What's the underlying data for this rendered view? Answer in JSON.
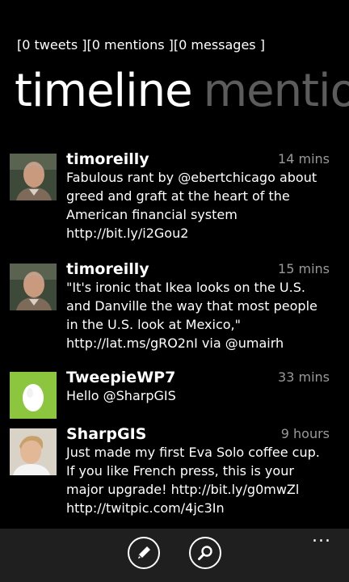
{
  "counters": "[0 tweets ][0 mentions ][0 messages ]",
  "pivot": {
    "active": "timeline",
    "next": "mentions"
  },
  "tweets": [
    {
      "user": "timoreilly",
      "time": "14 mins",
      "text": "Fabulous rant by @ebertchicago about greed and graft at the heart of the American financial system http://bit.ly/i2Gou2"
    },
    {
      "user": "timoreilly",
      "time": "15 mins",
      "text": "\"It's ironic that Ikea looks on the U.S. and Danville the way that most people in the U.S. look at Mexico,\" http://lat.ms/gRO2nI via @umairh"
    },
    {
      "user": "TweepieWP7",
      "time": "33 mins",
      "text": "Hello @SharpGIS"
    },
    {
      "user": "SharpGIS",
      "time": "9 hours",
      "text": "Just made my first Eva Solo coffee cup. If you like French press, this is your major upgrade! http://bit.ly/g0mwZl http://twitpic.com/4jc3In"
    }
  ],
  "appbar": {
    "compose_icon": "pencil-icon",
    "search_icon": "search-icon",
    "more_label": "..."
  },
  "colors": {
    "background": "#000000",
    "inactive_pivot": "#5c5c5c",
    "timestamp": "#999999",
    "appbar": "#1f1f1f",
    "tweepie_avatar": "#8cc63f"
  }
}
